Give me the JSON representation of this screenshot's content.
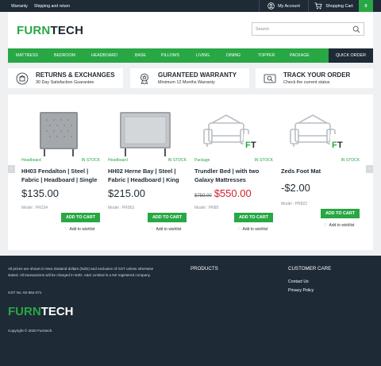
{
  "topbar": {
    "links": [
      "Warranty",
      "Shipping and return"
    ],
    "account_label": "My Account",
    "cart_label": "Shopping Cart",
    "cart_count": "0"
  },
  "header": {
    "logo_part1": "FURN",
    "logo_part2": "TECH",
    "search_placeholder": "Search"
  },
  "nav": {
    "items": [
      "Mattress",
      "Bedroom",
      "Headboard",
      "Base",
      "Pillows",
      "Living",
      "Dining",
      "Topper",
      "Package"
    ],
    "quick_order": "Quick Order"
  },
  "features": [
    {
      "title": "Returns & Exchanges",
      "subtitle": "30 Day Satisfaction Guarantee",
      "icon": "returns-box-icon"
    },
    {
      "title": "Guranteed Warranty",
      "subtitle": "Minimum 12 Months Warranty",
      "icon": "warranty-badge-icon"
    },
    {
      "title": "Track Your Order",
      "subtitle": "Check the current status",
      "icon": "track-order-icon"
    }
  ],
  "products": [
    {
      "category": "Headboard",
      "stock": "In Stock",
      "name": "HH03 Fendalton | Steel | Fabric | Headboard | Single",
      "price": "$135.00",
      "old_price": "",
      "model": "Model : PR234",
      "add_to_cart": "Add to Cart",
      "wishlist": "Add to wishlist",
      "image": "headboard-tufted"
    },
    {
      "category": "Headboard",
      "stock": "In Stock",
      "name": "HH02 Herne Bay | Steel | Fabric | Headboard | King",
      "price": "$215.00",
      "old_price": "",
      "model": "Model : PR563",
      "add_to_cart": "Add to Cart",
      "wishlist": "Add to wishlist",
      "image": "headboard-panel"
    },
    {
      "category": "Package",
      "stock": "In Stock",
      "name": "Trundler Bed | with two Galaxy Mattresses",
      "price": "$550.00",
      "old_price": "$759.00",
      "model": "Model : PR85",
      "add_to_cart": "Add to Cart",
      "wishlist": "Add to wishlist",
      "image": "placeholder-sofa-ft"
    },
    {
      "category": "",
      "stock": "In Stock",
      "name": "Zeds Foot Mat",
      "price": "-$2.00",
      "old_price": "",
      "model": "Model : PR822",
      "add_to_cart": "Add to Cart",
      "wishlist": "Add to wishlist",
      "image": "placeholder-sofa-ft"
    }
  ],
  "placeholder_logo": {
    "f": "F",
    "t": "T"
  },
  "footer": {
    "legal": "All prices are shown in New Zealand dollars (NZD) and exclusive of GST unless otherwise stated. All transactions will be charged in NZD. A&G Limited is a NZ registered company.",
    "gst": "GST No. 92-664-071",
    "logo_part1": "FURN",
    "logo_part2": "TECH",
    "copyright": "Copyright © 2020 Furntech.",
    "products_heading": "Products",
    "customer_care_heading": "Customer Care",
    "customer_care_links": [
      "Contact Us",
      "Privacy Policy"
    ]
  },
  "colors": {
    "brand_green": "#28a745",
    "navy": "#1e2a36",
    "sale_red": "#d21f2d"
  }
}
